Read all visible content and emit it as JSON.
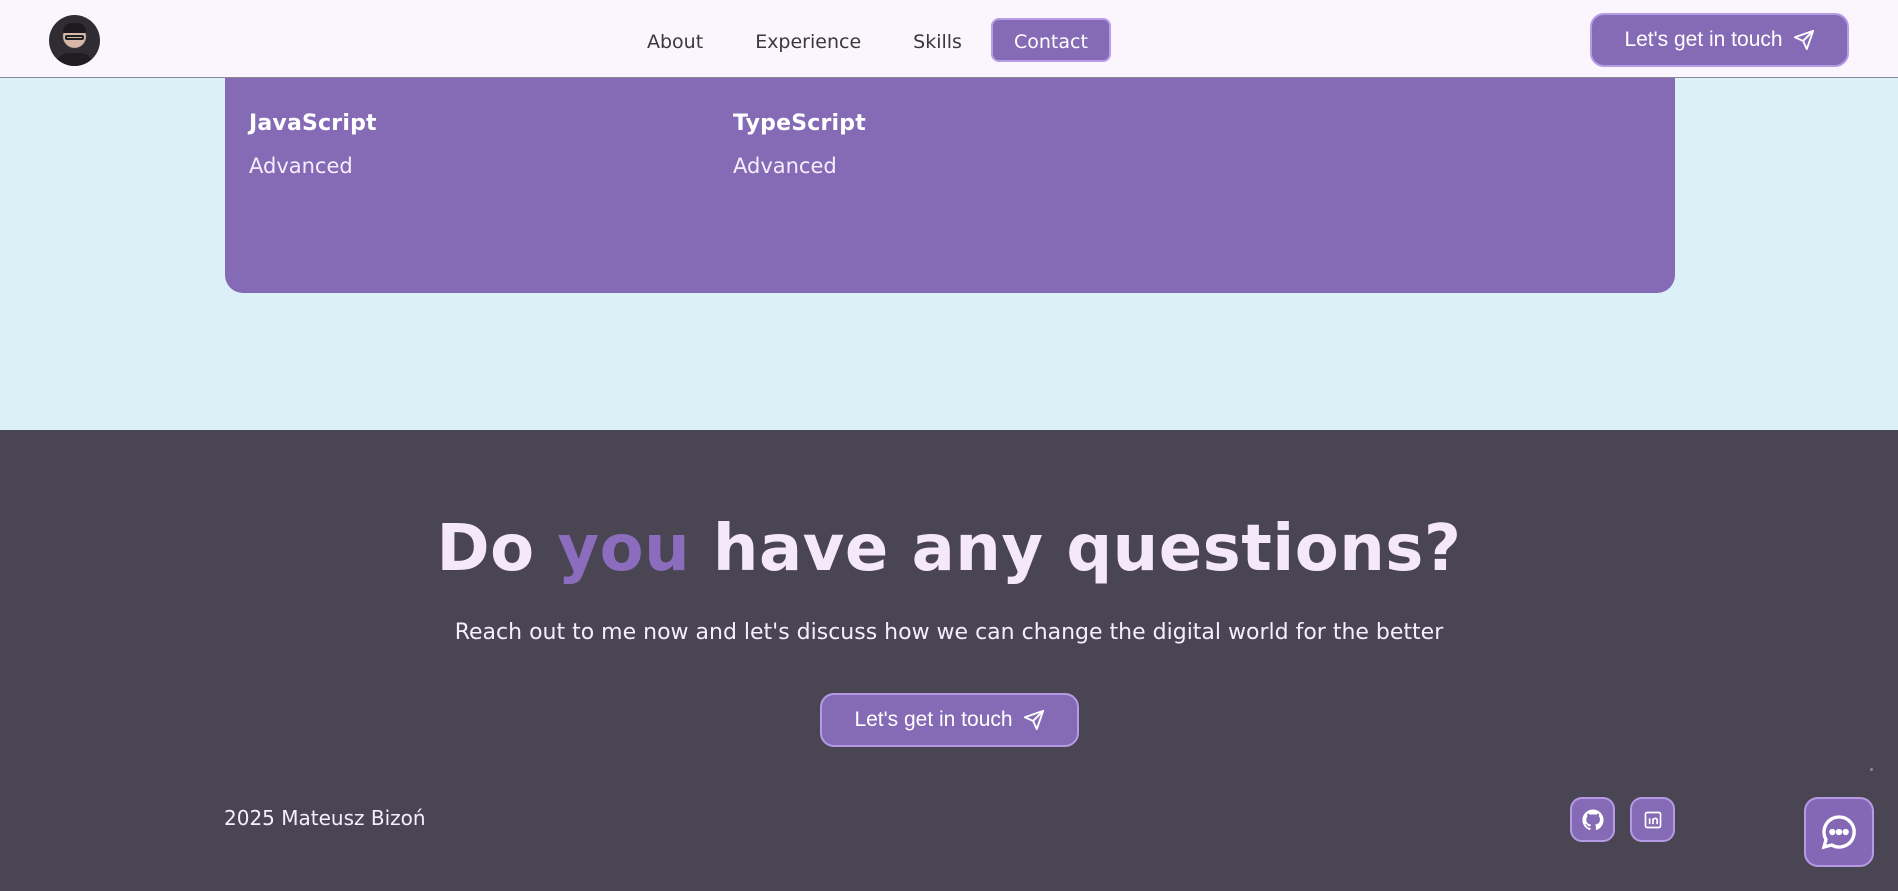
{
  "header": {
    "nav": [
      {
        "label": "About",
        "active": false
      },
      {
        "label": "Experience",
        "active": false
      },
      {
        "label": "Skills",
        "active": false
      },
      {
        "label": "Contact",
        "active": true
      }
    ],
    "cta_label": "Let's get in touch"
  },
  "skills": {
    "items": [
      {
        "name": "JavaScript",
        "level": "Advanced"
      },
      {
        "name": "TypeScript",
        "level": "Advanced"
      }
    ]
  },
  "contact": {
    "headline_pre": "Do ",
    "headline_accent": "you",
    "headline_post": " have any questions?",
    "subline": "Reach out to me now and let's discuss how we can change the digital world for the better",
    "cta_label": "Let's get in touch"
  },
  "footer": {
    "copyright": "2025 Mateusz Bizoń",
    "social": [
      {
        "icon": "github-icon"
      },
      {
        "icon": "linkedin-icon"
      }
    ]
  },
  "colors": {
    "accent": "#856bb5",
    "background_light": "#dcf1f7",
    "background_dark": "#4a4553",
    "header_bg": "#fbf5fd"
  }
}
